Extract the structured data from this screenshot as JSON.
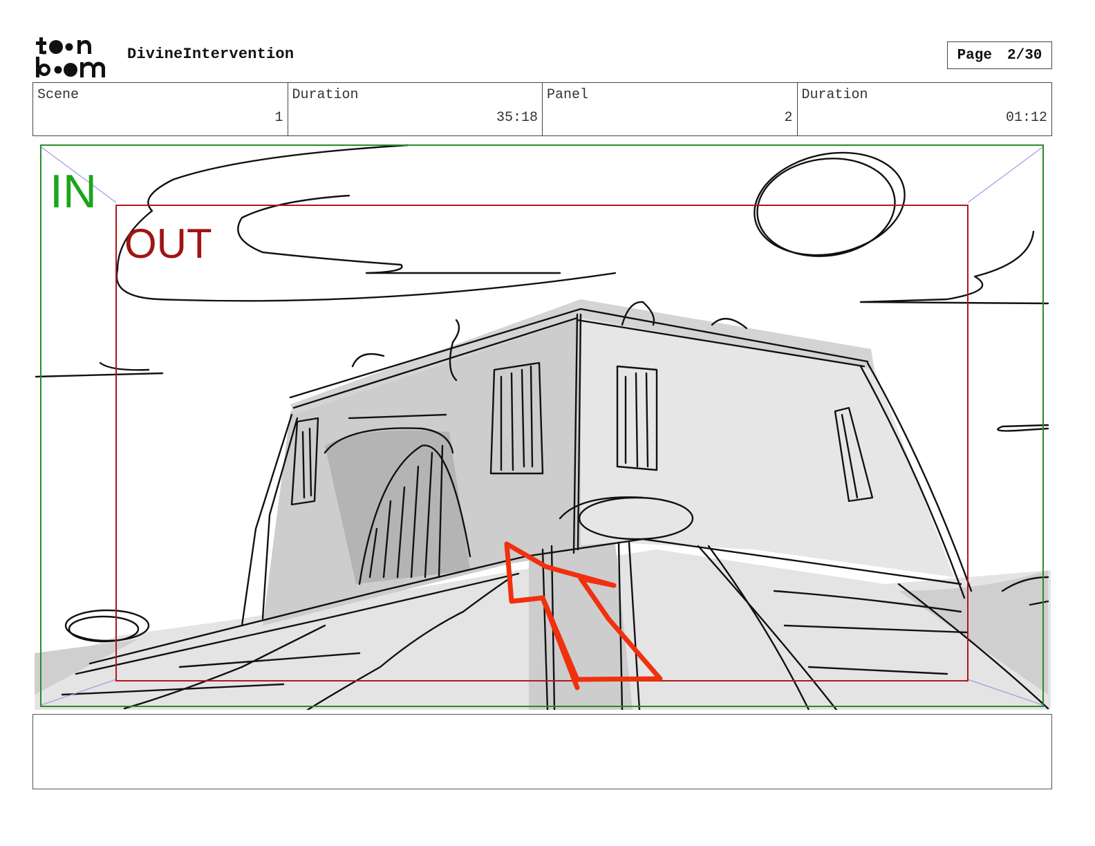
{
  "header": {
    "project_title": "DivineIntervention",
    "page_label": "Page",
    "page_value": "2/30"
  },
  "info": {
    "scene_label": "Scene",
    "scene_value": "1",
    "scene_duration_label": "Duration",
    "scene_duration_value": "35:18",
    "panel_label": "Panel",
    "panel_value": "2",
    "panel_duration_label": "Duration",
    "panel_duration_value": "01:12"
  },
  "frame": {
    "in_label": "IN",
    "out_label": "OUT",
    "in_color": "#1aa51a",
    "out_color": "#a01414",
    "arrow_color": "#f0300e"
  },
  "notes": {
    "text": ""
  }
}
